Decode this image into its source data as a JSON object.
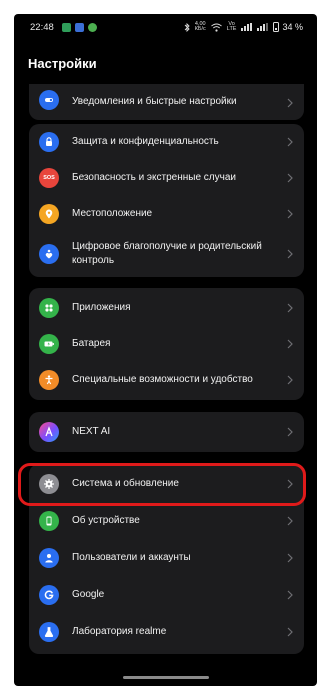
{
  "status_bar": {
    "time": "22:48",
    "net_speed_top": "4,00",
    "net_speed_bottom": "КБ/с",
    "network_top": "Vo",
    "network_bottom": "LTE",
    "battery": "34 %"
  },
  "header": {
    "title": "Настройки"
  },
  "groups": [
    {
      "items": [
        {
          "label": "Уведомления и быстрые настройки",
          "icon": "notifications-icon",
          "color": "#2a6ef0"
        }
      ]
    },
    {
      "items": [
        {
          "label": "Защита и конфиденциальность",
          "icon": "lock-icon",
          "color": "#2a6ef0"
        },
        {
          "label": "Безопасность и экстренные случаи",
          "icon": "sos-icon",
          "color": "#e8453c",
          "icon_text": "SOS"
        },
        {
          "label": "Местоположение",
          "icon": "location-icon",
          "color": "#f5a623"
        },
        {
          "label": "Цифровое благополучие и родительский контроль",
          "icon": "digital-wellbeing-icon",
          "color": "#2a6ef0"
        }
      ]
    },
    {
      "items": [
        {
          "label": "Приложения",
          "icon": "apps-icon",
          "color": "#34b34a"
        },
        {
          "label": "Батарея",
          "icon": "battery-icon",
          "color": "#34b34a"
        },
        {
          "label": "Специальные возможности и удобство",
          "icon": "accessibility-icon",
          "color": "#f28c28"
        }
      ]
    },
    {
      "items": [
        {
          "label": "NEXT AI",
          "icon": "next-ai-icon",
          "color": "#7a4dff"
        }
      ]
    },
    {
      "items": [
        {
          "label": "Система и обновление",
          "icon": "gear-icon",
          "color": "#8e8e93"
        },
        {
          "label": "Об устройстве",
          "icon": "phone-icon",
          "color": "#34b34a"
        },
        {
          "label": "Пользователи и аккаунты",
          "icon": "user-icon",
          "color": "#2a6ef0"
        },
        {
          "label": "Google",
          "icon": "google-icon",
          "color": "#2a6ef0"
        },
        {
          "label": "Лаборатория realme",
          "icon": "lab-icon",
          "color": "#2a6ef0"
        }
      ]
    }
  ]
}
